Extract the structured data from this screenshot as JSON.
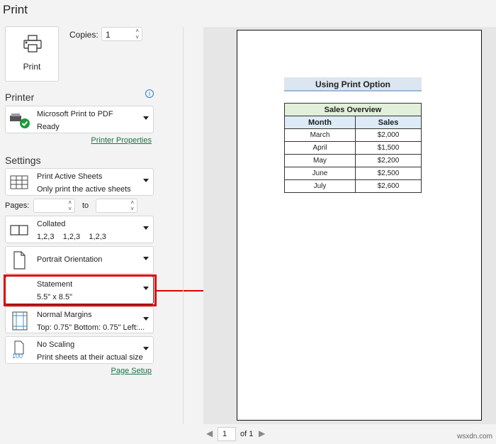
{
  "title": "Print",
  "print_button": "Print",
  "copies": {
    "label": "Copies:",
    "value": "1"
  },
  "printer": {
    "heading": "Printer",
    "name": "Microsoft Print to PDF",
    "status": "Ready",
    "properties_link": "Printer Properties"
  },
  "settings": {
    "heading": "Settings",
    "sheets": {
      "line1": "Print Active Sheets",
      "line2": "Only print the active sheets"
    },
    "pages": {
      "label": "Pages:",
      "to": "to",
      "from_value": "",
      "to_value": ""
    },
    "collation": {
      "line1": "Collated",
      "line2a": "1,2,3",
      "line2b": "1,2,3",
      "line2c": "1,2,3"
    },
    "orientation": "Portrait Orientation",
    "paper": {
      "line1": "Statement",
      "line2": "5.5\" x 8.5\""
    },
    "margins": {
      "line1": "Normal Margins",
      "line2": "Top: 0.75\" Bottom: 0.75\" Left:..."
    },
    "scaling": {
      "line1": "No Scaling",
      "line2": "Print sheets at their actual size",
      "icon_text": "100"
    },
    "page_setup_link": "Page Setup"
  },
  "preview": {
    "sheet_title": "Using Print Option",
    "table_title": "Sales Overview",
    "headers": [
      "Month",
      "Sales"
    ],
    "rows": [
      [
        "March",
        "$2,000"
      ],
      [
        "April",
        "$1,500"
      ],
      [
        "May",
        "$2,200"
      ],
      [
        "June",
        "$2,500"
      ],
      [
        "July",
        "$2,600"
      ]
    ]
  },
  "pager": {
    "current": "1",
    "of": "of 1"
  },
  "watermark": "wsxdn.com",
  "colors": {
    "highlight": "#e00000",
    "link": "#1e7145",
    "title_fill": "#dce6f1",
    "table_title_fill": "#e2efda",
    "header_fill": "#ddebf7"
  }
}
